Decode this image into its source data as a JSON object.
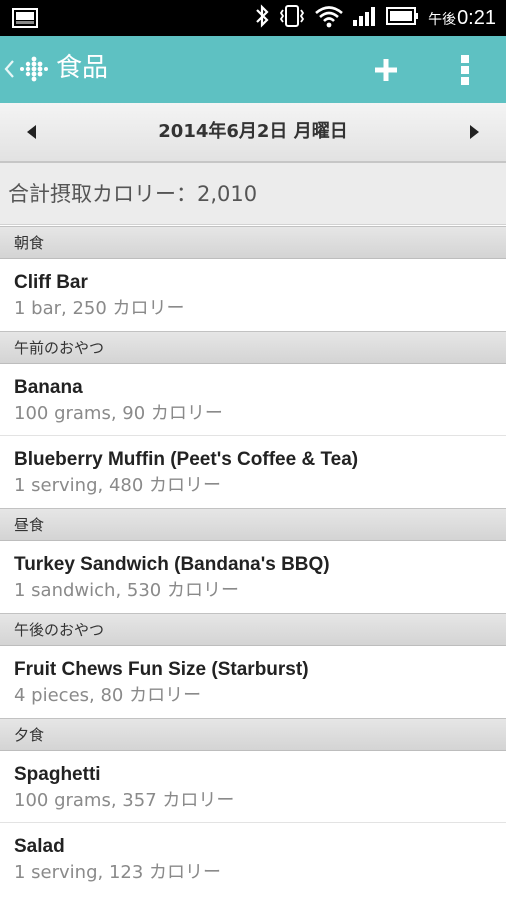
{
  "status_bar": {
    "ampm": "午後",
    "time": "0:21",
    "icons": [
      "image-icon",
      "bluetooth-icon",
      "vibrate-icon",
      "wifi-icon",
      "signal-icon",
      "battery-icon"
    ]
  },
  "action_bar": {
    "title": "食品",
    "color": "#5ec1c2",
    "icons": [
      "back-icon",
      "fitbit-logo",
      "add-icon",
      "overflow-menu-icon"
    ]
  },
  "date_bar": {
    "date": "2014年6月2日 月曜日"
  },
  "total": {
    "text": "合計摂取カロリー：2,010"
  },
  "meals": [
    {
      "section": "朝食",
      "items": [
        {
          "name": "Cliff Bar",
          "detail": "1 bar, 250 カロリー"
        }
      ]
    },
    {
      "section": "午前のおやつ",
      "items": [
        {
          "name": "Banana",
          "detail": "100 grams, 90 カロリー"
        },
        {
          "name": "Blueberry Muffin (Peet's Coffee & Tea)",
          "detail": "1 serving, 480 カロリー"
        }
      ]
    },
    {
      "section": "昼食",
      "items": [
        {
          "name": "Turkey Sandwich (Bandana's BBQ)",
          "detail": "1 sandwich, 530 カロリー"
        }
      ]
    },
    {
      "section": "午後のおやつ",
      "items": [
        {
          "name": "Fruit Chews Fun Size (Starburst)",
          "detail": "4 pieces, 80 カロリー"
        }
      ]
    },
    {
      "section": "夕食",
      "items": [
        {
          "name": "Spaghetti",
          "detail": "100 grams, 357 カロリー"
        },
        {
          "name": "Salad",
          "detail": "1 serving, 123 カロリー"
        }
      ]
    }
  ]
}
